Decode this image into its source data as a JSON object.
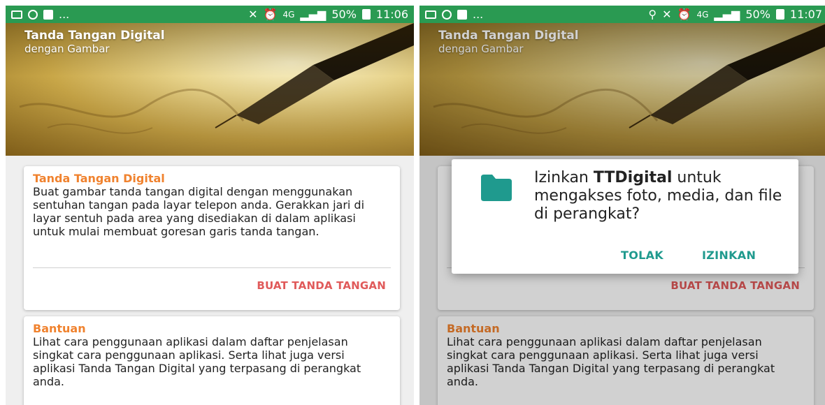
{
  "left": {
    "statusbar": {
      "left_more": "...",
      "signal_label": "4G",
      "battery": "50%",
      "time": "11:06"
    },
    "hero": {
      "title": "Tanda Tangan Digital",
      "subtitle": "dengan Gambar"
    },
    "card1": {
      "title": "Tanda Tangan Digital",
      "body": "Buat gambar tanda tangan digital dengan menggunakan sentuhan tangan pada layar telepon anda. Gerakkan jari di layar sentuh pada area yang disediakan di dalam aplikasi untuk mulai membuat goresan garis tanda tangan.",
      "action": "BUAT TANDA TANGAN"
    },
    "card2": {
      "title": "Bantuan",
      "body": "Lihat cara penggunaan aplikasi dalam daftar penjelasan singkat cara penggunaan aplikasi. Serta lihat juga versi aplikasi Tanda Tangan Digital yang terpasang di perangkat anda."
    }
  },
  "right": {
    "statusbar": {
      "left_more": "...",
      "signal_label": "4G",
      "battery": "50%",
      "time": "11:07"
    },
    "hero": {
      "title": "Tanda Tangan Digital",
      "subtitle": "dengan Gambar"
    },
    "card1": {
      "action": "BUAT TANDA TANGAN"
    },
    "card2": {
      "title": "Bantuan",
      "body": "Lihat cara penggunaan aplikasi dalam daftar penjelasan singkat cara penggunaan aplikasi. Serta lihat juga versi aplikasi Tanda Tangan Digital yang terpasang di perangkat anda."
    },
    "dialog": {
      "prefix": "Izinkan ",
      "app_name": "TTDigital",
      "suffix": " untuk mengakses foto, media, dan file di perangkat?",
      "deny_label": "TOLAK",
      "allow_label": "IZINKAN"
    }
  },
  "colors": {
    "statusbar": "#2a9a52",
    "card_title": "#f0822e",
    "action": "#e05a5a",
    "dialog_button": "#1f9a8e",
    "folder_icon": "#1f9a8e"
  },
  "icons": [
    "gallery-icon",
    "whatsapp-icon",
    "facebook-icon",
    "location-icon",
    "mute-icon",
    "alarm-icon",
    "signal-icon",
    "battery-icon",
    "folder-icon",
    "pen-nib-icon"
  ]
}
